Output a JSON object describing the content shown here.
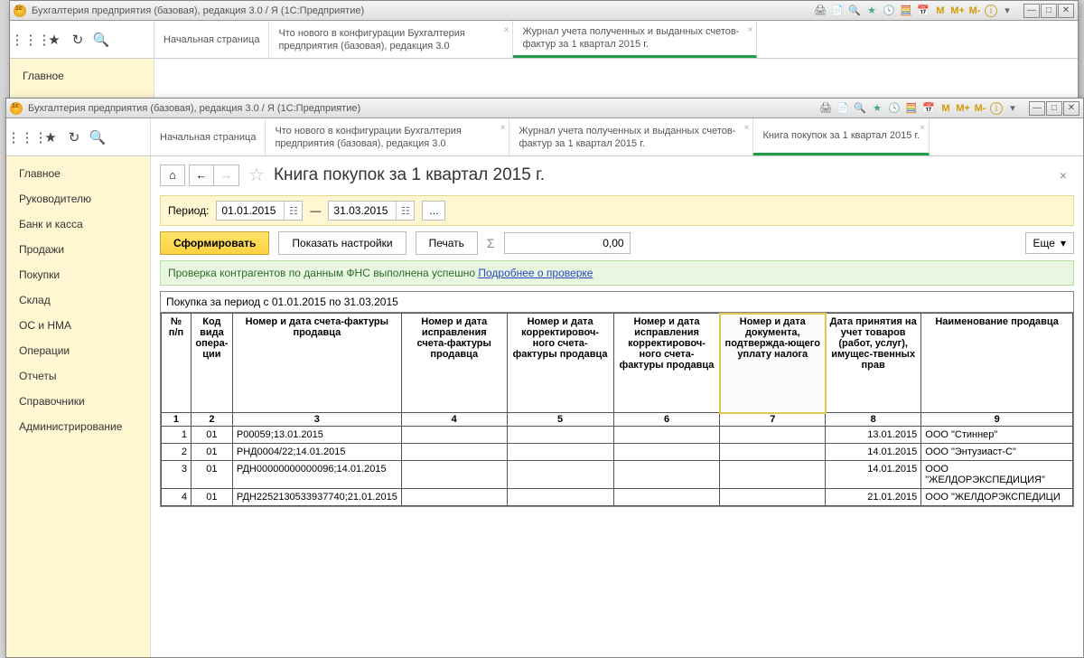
{
  "app_title": "Бухгалтерия предприятия (базовая), редакция 3.0 / Я   (1С:Предприятие)",
  "sys_labels": {
    "m": "M",
    "mplus": "M+",
    "mminus": "M-",
    "info": "i"
  },
  "tabs_back": [
    "Начальная страница",
    "Что нового в конфигурации Бухгалтерия предприятия (базовая), редакция 3.0",
    "Журнал учета полученных и выданных счетов-фактур за 1 квартал 2015 г."
  ],
  "tabs_front": [
    "Начальная страница",
    "Что нового в конфигурации Бухгалтерия предприятия (базовая), редакция 3.0",
    "Журнал учета полученных и выданных счетов-фактур за 1 квартал 2015 г.",
    "Книга покупок за 1 квартал 2015 г."
  ],
  "sidebar_back": [
    "Главное"
  ],
  "sidebar": [
    "Главное",
    "Руководителю",
    "Банк и касса",
    "Продажи",
    "Покупки",
    "Склад",
    "ОС и НМА",
    "Операции",
    "Отчеты",
    "Справочники",
    "Администрирование"
  ],
  "page_title": "Книга покупок за 1 квартал 2015 г.",
  "period": {
    "label": "Период:",
    "from": "01.01.2015",
    "dash": "—",
    "to": "31.03.2015",
    "ellips": "..."
  },
  "actions": {
    "generate": "Сформировать",
    "settings": "Показать настройки",
    "print": "Печать",
    "sigma": "Σ",
    "sum": "0,00",
    "more": "Еще"
  },
  "info": {
    "text": "Проверка контрагентов по данным ФНС выполнена успешно ",
    "link": "Подробнее о проверке"
  },
  "report_caption": "Покупка за период с 01.01.2015 по 31.03.2015",
  "columns": [
    "№ п/п",
    "Код вида опера-ции",
    "Номер и дата счета-фактуры продавца",
    "Номер и дата исправления счета-фактуры продавца",
    "Номер и дата корректировоч-ного счета-фактуры продавца",
    "Номер и дата исправления корректировоч-ного счета-фактуры продавца",
    "Номер и дата документа, подтвержда-ющего уплату налога",
    "Дата принятия на учет товаров (работ, услуг), имущес-твенных прав",
    "Наименование продавца"
  ],
  "col_nums": [
    "1",
    "2",
    "3",
    "4",
    "5",
    "6",
    "7",
    "8",
    "9"
  ],
  "rows": [
    {
      "n": "1",
      "code": "01",
      "sf": "Р00059;13.01.2015",
      "date": "13.01.2015",
      "seller": "ООО \"Стиннер\""
    },
    {
      "n": "2",
      "code": "01",
      "sf": "РНД0004/22;14.01.2015",
      "date": "14.01.2015",
      "seller": "ООО \"Энтузиаст-С\""
    },
    {
      "n": "3",
      "code": "01",
      "sf": "РДН00000000000096;14.01.2015",
      "date": "14.01.2015",
      "seller": "ООО \"ЖЕЛДОРЭКСПЕДИЦИЯ\""
    },
    {
      "n": "4",
      "code": "01",
      "sf": "РДН2252130533937740;21.01.2015",
      "date": "21.01.2015",
      "seller": "ООО \"ЖЕЛДОРЭКСПЕДИЦИ"
    }
  ]
}
